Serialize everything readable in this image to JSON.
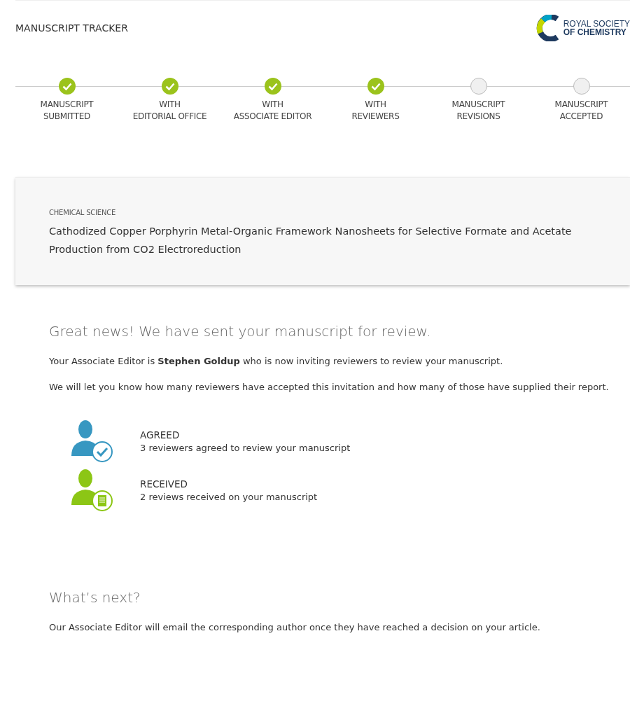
{
  "header": {
    "title": "MANUSCRIPT TRACKER",
    "logo_lines": [
      "ROYAL SOCIETY",
      "OF CHEMISTRY"
    ]
  },
  "steps": [
    {
      "label_lines": [
        "MANUSCRIPT",
        "SUBMITTED"
      ],
      "done": true
    },
    {
      "label_lines": [
        "WITH",
        "EDITORIAL OFFICE"
      ],
      "done": true
    },
    {
      "label_lines": [
        "WITH",
        "ASSOCIATE EDITOR"
      ],
      "done": true
    },
    {
      "label_lines": [
        "WITH",
        "REVIEWERS"
      ],
      "done": true
    },
    {
      "label_lines": [
        "MANUSCRIPT",
        "REVISIONS"
      ],
      "done": false
    },
    {
      "label_lines": [
        "MANUSCRIPT",
        "ACCEPTED"
      ],
      "done": false
    }
  ],
  "article": {
    "journal": "CHEMICAL SCIENCE",
    "title": "Cathodized Copper Porphyrin Metal-Organic Framework Nanosheets for Selective Formate and Acetate Production from CO2 Electroreduction"
  },
  "status": {
    "heading": "Great news! We have sent your manuscript for review.",
    "paragraphs": [
      "Your Associate Editor is **Stephen Goldup** who is now inviting reviewers to review your manuscript.",
      "We will let you know how many reviewers have accepted this invitation and how many of those have supplied their report."
    ]
  },
  "review_stats": [
    {
      "kind": "agreed",
      "label": "AGREED",
      "text": "3 reviewers agreed to review your manuscript"
    },
    {
      "kind": "received",
      "label": "RECEIVED",
      "text": "2 reviews received on your manuscript"
    }
  ],
  "next": {
    "heading": "What’s next?",
    "text": "Our Associate Editor will email the corresponding author once they have reached a decision on your article."
  }
}
